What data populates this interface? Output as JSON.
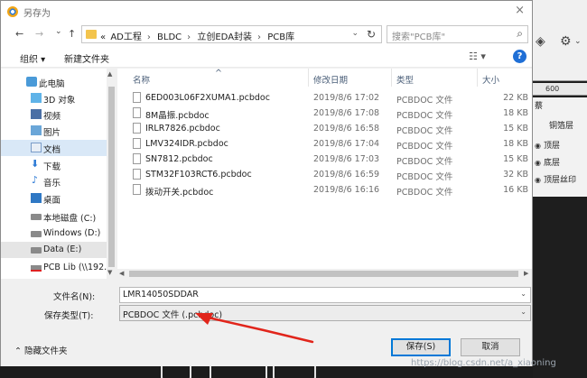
{
  "dialog": {
    "title": "另存为",
    "close": "×"
  },
  "nav": {
    "back": "←",
    "forward": "→",
    "recent": "⌄",
    "up": "↑",
    "breadcrumbs": [
      "«",
      "AD工程",
      "BLDC",
      "立创EDA封装",
      "PCB库"
    ],
    "crumb_sep": "›",
    "refresh": "↻",
    "search_placeholder": "搜索\"PCB库\""
  },
  "toolbar": {
    "organize": "组织 ▾",
    "new_folder": "新建文件夹",
    "view": "☷ ▾",
    "help": "?"
  },
  "sidebar": {
    "items": [
      {
        "label": "此电脑",
        "icon": "computer-icon"
      },
      {
        "label": "3D 对象",
        "icon": "3d-objects-icon"
      },
      {
        "label": "视频",
        "icon": "video-icon"
      },
      {
        "label": "图片",
        "icon": "pictures-icon"
      },
      {
        "label": "文档",
        "icon": "documents-icon"
      },
      {
        "label": "下载",
        "icon": "downloads-icon"
      },
      {
        "label": "音乐",
        "icon": "music-icon"
      },
      {
        "label": "桌面",
        "icon": "desktop-icon"
      },
      {
        "label": "本地磁盘 (C:)",
        "icon": "drive-icon"
      },
      {
        "label": "Windows (D:)",
        "icon": "drive-icon"
      },
      {
        "label": "Data (E:)",
        "icon": "drive-icon"
      },
      {
        "label": "PCB Lib (\\\\192.",
        "icon": "network-drive-icon"
      }
    ]
  },
  "columns": {
    "name": "名称",
    "date": "修改日期",
    "type": "类型",
    "size": "大小",
    "sort_indicator": "^"
  },
  "files": [
    {
      "name": "6ED003L06F2XUMA1.pcbdoc",
      "date": "2019/8/6 17:02",
      "type": "PCBDOC 文件",
      "size": "22 KB"
    },
    {
      "name": "8M晶振.pcbdoc",
      "date": "2019/8/6 17:08",
      "type": "PCBDOC 文件",
      "size": "18 KB"
    },
    {
      "name": "IRLR7826.pcbdoc",
      "date": "2019/8/6 16:58",
      "type": "PCBDOC 文件",
      "size": "15 KB"
    },
    {
      "name": "LMV324IDR.pcbdoc",
      "date": "2019/8/6 17:04",
      "type": "PCBDOC 文件",
      "size": "18 KB"
    },
    {
      "name": "SN7812.pcbdoc",
      "date": "2019/8/6 17:03",
      "type": "PCBDOC 文件",
      "size": "15 KB"
    },
    {
      "name": "STM32F103RCT6.pcbdoc",
      "date": "2019/8/6 16:59",
      "type": "PCBDOC 文件",
      "size": "32 KB"
    },
    {
      "name": "拨动开关.pcbdoc",
      "date": "2019/8/6 16:16",
      "type": "PCBDOC 文件",
      "size": "16 KB"
    }
  ],
  "form": {
    "filename_label": "文件名(N):",
    "filename_value": "LMR14050SDDAR",
    "filetype_label": "保存类型(T):",
    "filetype_value": "PCBDOC 文件 (.pcbdoc)",
    "dropdown": "⌄"
  },
  "footer": {
    "hide_folders": "⌃ 隐藏文件夹",
    "save": "保存(S)",
    "cancel": "取消"
  },
  "background_app": {
    "ruler_label": "600",
    "panel_header": "蔡",
    "layers": [
      "铜箔层",
      "顶层",
      "底层",
      "顶层丝印"
    ]
  },
  "watermark": "https://blog.csdn.net/a_xiaoning",
  "colors": {
    "accent": "#0078d7",
    "annotation": "#e1251b",
    "selected": "#d9e8f7"
  }
}
